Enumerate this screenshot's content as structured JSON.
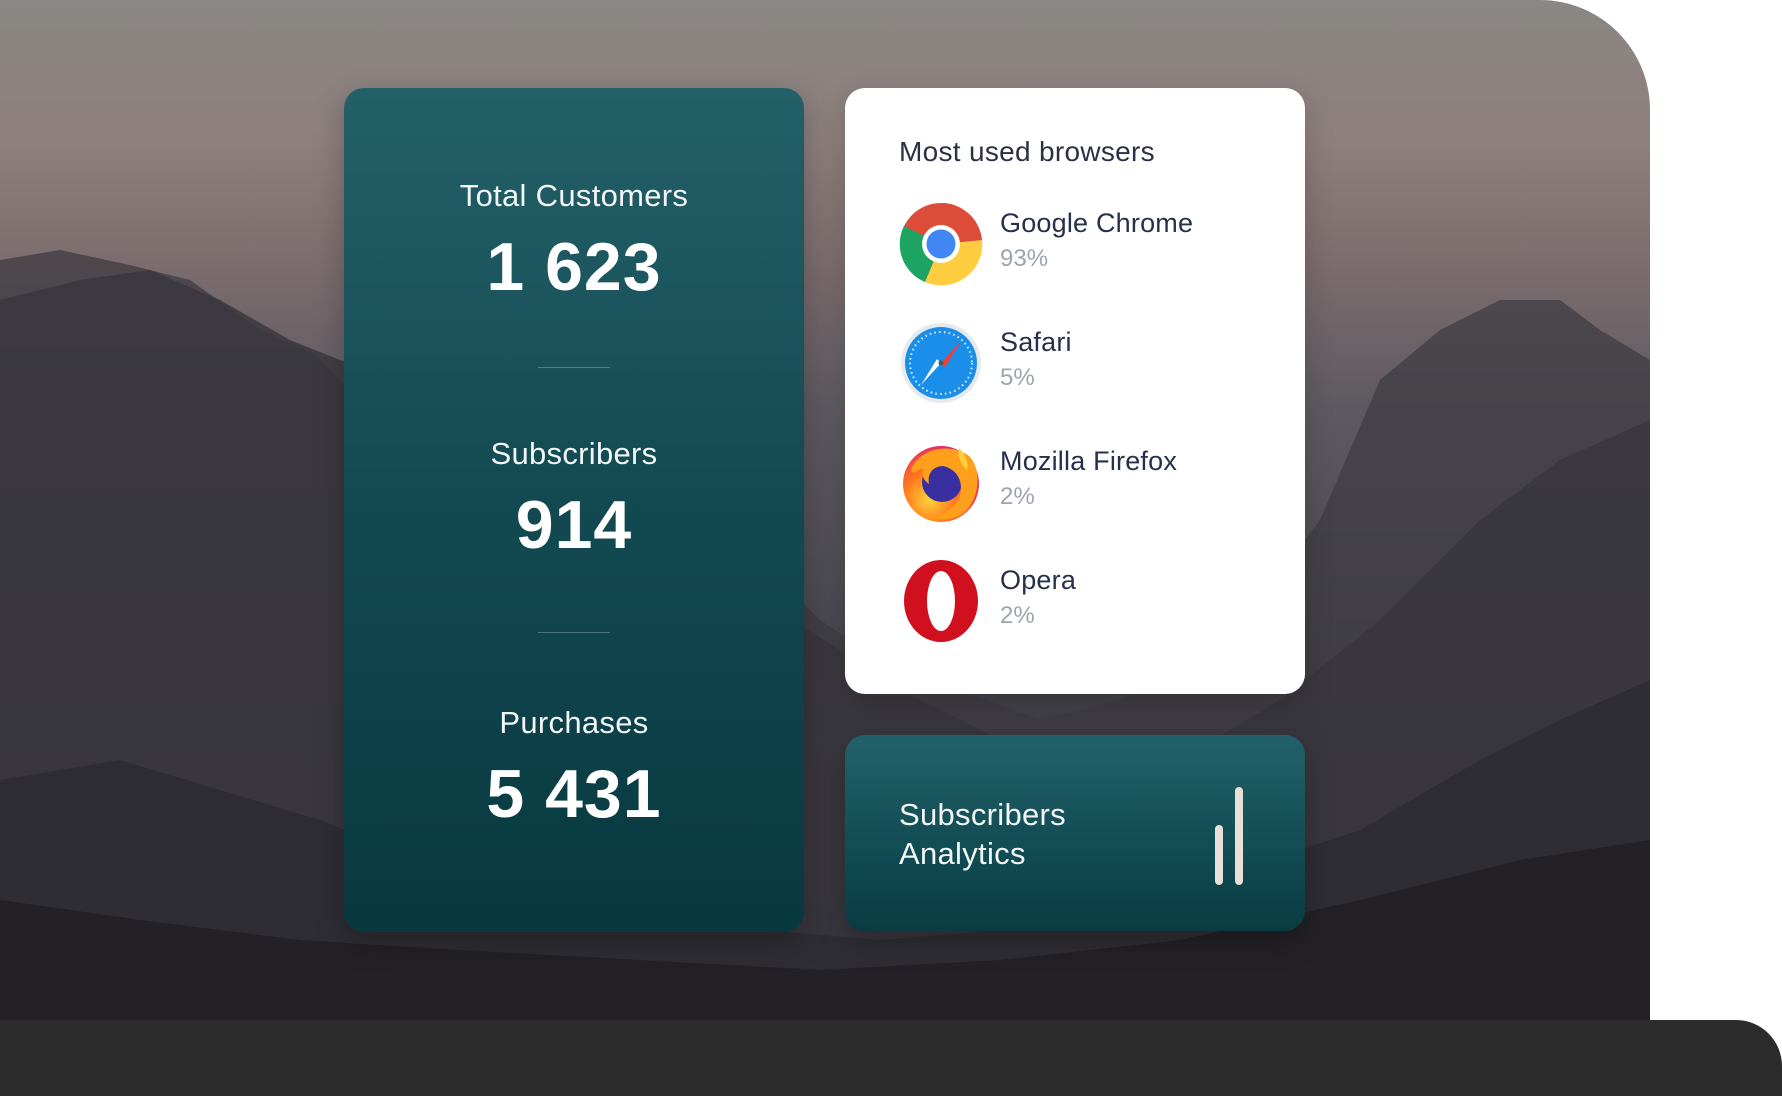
{
  "stats": [
    {
      "label": "Total Customers",
      "value": "1 623"
    },
    {
      "label": "Subscribers",
      "value": "914"
    },
    {
      "label": "Purchases",
      "value": "5 431"
    }
  ],
  "browsers": {
    "title": "Most used browsers",
    "items": [
      {
        "name": "Google Chrome",
        "percent": "93%",
        "icon": "chrome-icon"
      },
      {
        "name": "Safari",
        "percent": "5%",
        "icon": "safari-icon"
      },
      {
        "name": "Mozilla Firefox",
        "percent": "2%",
        "icon": "firefox-icon"
      },
      {
        "name": "Opera",
        "percent": "2%",
        "icon": "opera-icon"
      }
    ]
  },
  "analytics": {
    "label_line1": "Subscribers",
    "label_line2": "Analytics",
    "icon": "bar-chart-icon"
  },
  "colors": {
    "card_teal_top": "#246068",
    "card_teal_bottom": "#083840",
    "bottom_bar": "#2c2c2c",
    "text_dark": "#26304a",
    "text_muted": "#9ea4ae"
  }
}
